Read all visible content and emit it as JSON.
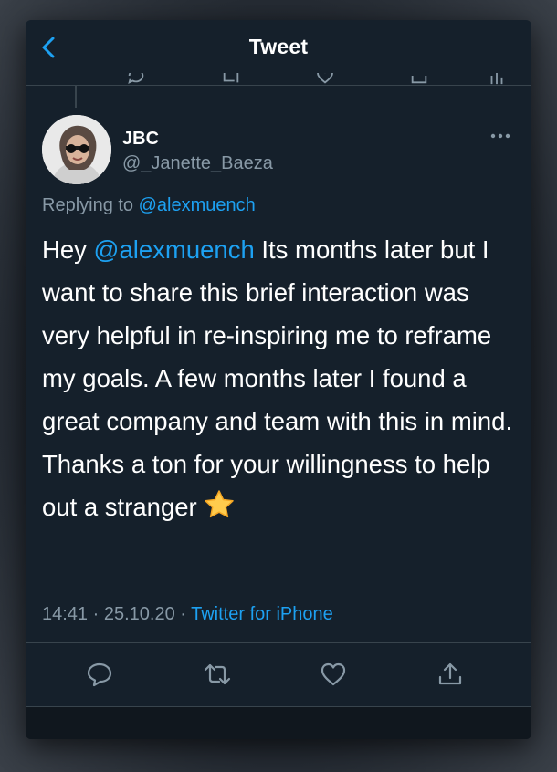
{
  "header": {
    "title": "Tweet"
  },
  "tweet": {
    "display_name": "JBC",
    "handle": "@_Janette_Baeza",
    "replying_prefix": "Replying to ",
    "replying_to": "@alexmuench",
    "text_prefix": "Hey ",
    "text_mention": "@alexmuench",
    "text_body": " Its months later but I want to share this brief interaction was very helpful in re-inspiring me to reframe my goals. A few months later I found a great company and team with this in mind. Thanks a ton for your willingness to help out a stranger ",
    "emoji": "star-emoji",
    "time": "14:41",
    "date": "25.10.20",
    "separator": " · ",
    "source": "Twitter for iPhone"
  },
  "icons": {
    "back": "chevron-left-icon",
    "more": "more-horizontal-icon",
    "reply": "reply-icon",
    "retweet": "retweet-icon",
    "like": "heart-icon",
    "share": "share-icon"
  },
  "colors": {
    "background": "#15202b",
    "accent": "#1da1f2",
    "text": "#ffffff",
    "secondary": "#8899a6",
    "divider": "#38444d"
  }
}
